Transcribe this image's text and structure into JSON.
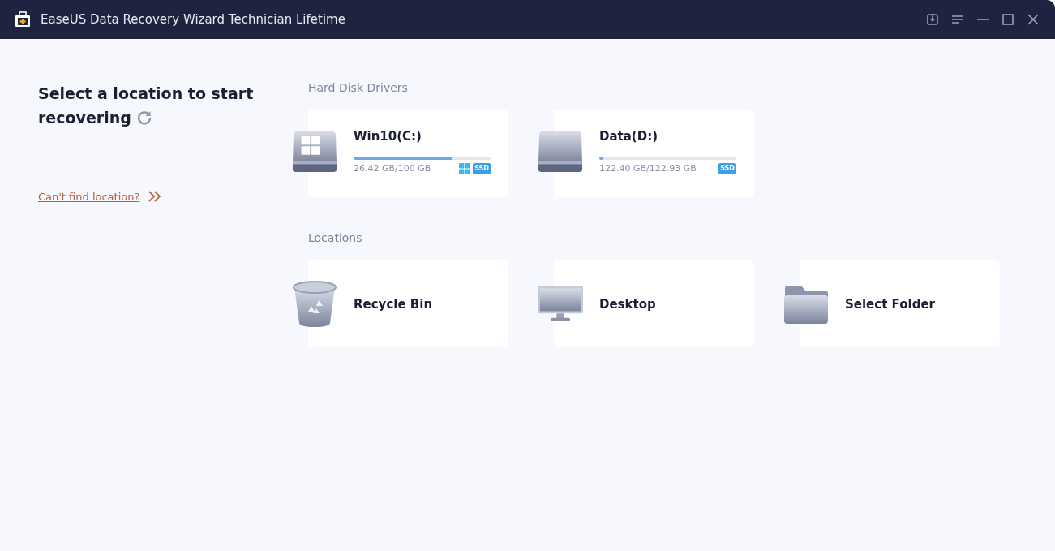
{
  "window": {
    "title": "EaseUS Data Recovery Wizard Technician Lifetime"
  },
  "sidebar": {
    "heading": "Select a location to start recovering",
    "help_link": "Can't find location?"
  },
  "hard_disk_drivers": {
    "label": "Hard Disk Drivers",
    "drives": [
      {
        "name": "Win10(C:)",
        "usage": "26.42 GB/100 GB",
        "level": 0.72,
        "system": true,
        "badge": "SSD"
      },
      {
        "name": "Data(D:)",
        "usage": "122.40 GB/122.93 GB",
        "level": 0.03,
        "system": false,
        "badge": "SSD"
      }
    ]
  },
  "locations": {
    "label": "Locations",
    "items": [
      {
        "kind": "recycle-bin",
        "name": "Recycle Bin"
      },
      {
        "kind": "desktop",
        "name": "Desktop"
      },
      {
        "kind": "folder",
        "name": "Select Folder"
      }
    ]
  }
}
